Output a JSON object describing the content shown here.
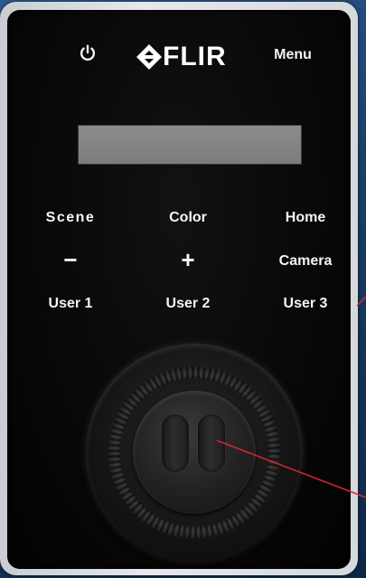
{
  "brand": {
    "logo_text": "FLIR"
  },
  "top_controls": {
    "power_icon": "power-icon",
    "menu_label": "Menu"
  },
  "keys": {
    "scene": "Scene",
    "color": "Color",
    "home": "Home",
    "minus": "−",
    "plus": "+",
    "camera": "Camera",
    "user1": "User 1",
    "user2": "User 2",
    "user3": "User 3"
  },
  "colors": {
    "background_blue": "#1b3d66",
    "panel_black": "#060606",
    "bezel_silver": "#d6d9dc",
    "lcd_gray": "#8a8c8d",
    "callout_line_red": "#d9262e",
    "label_white": "#f4f4f4"
  },
  "joystick": {
    "icon": "joystick-icon"
  }
}
